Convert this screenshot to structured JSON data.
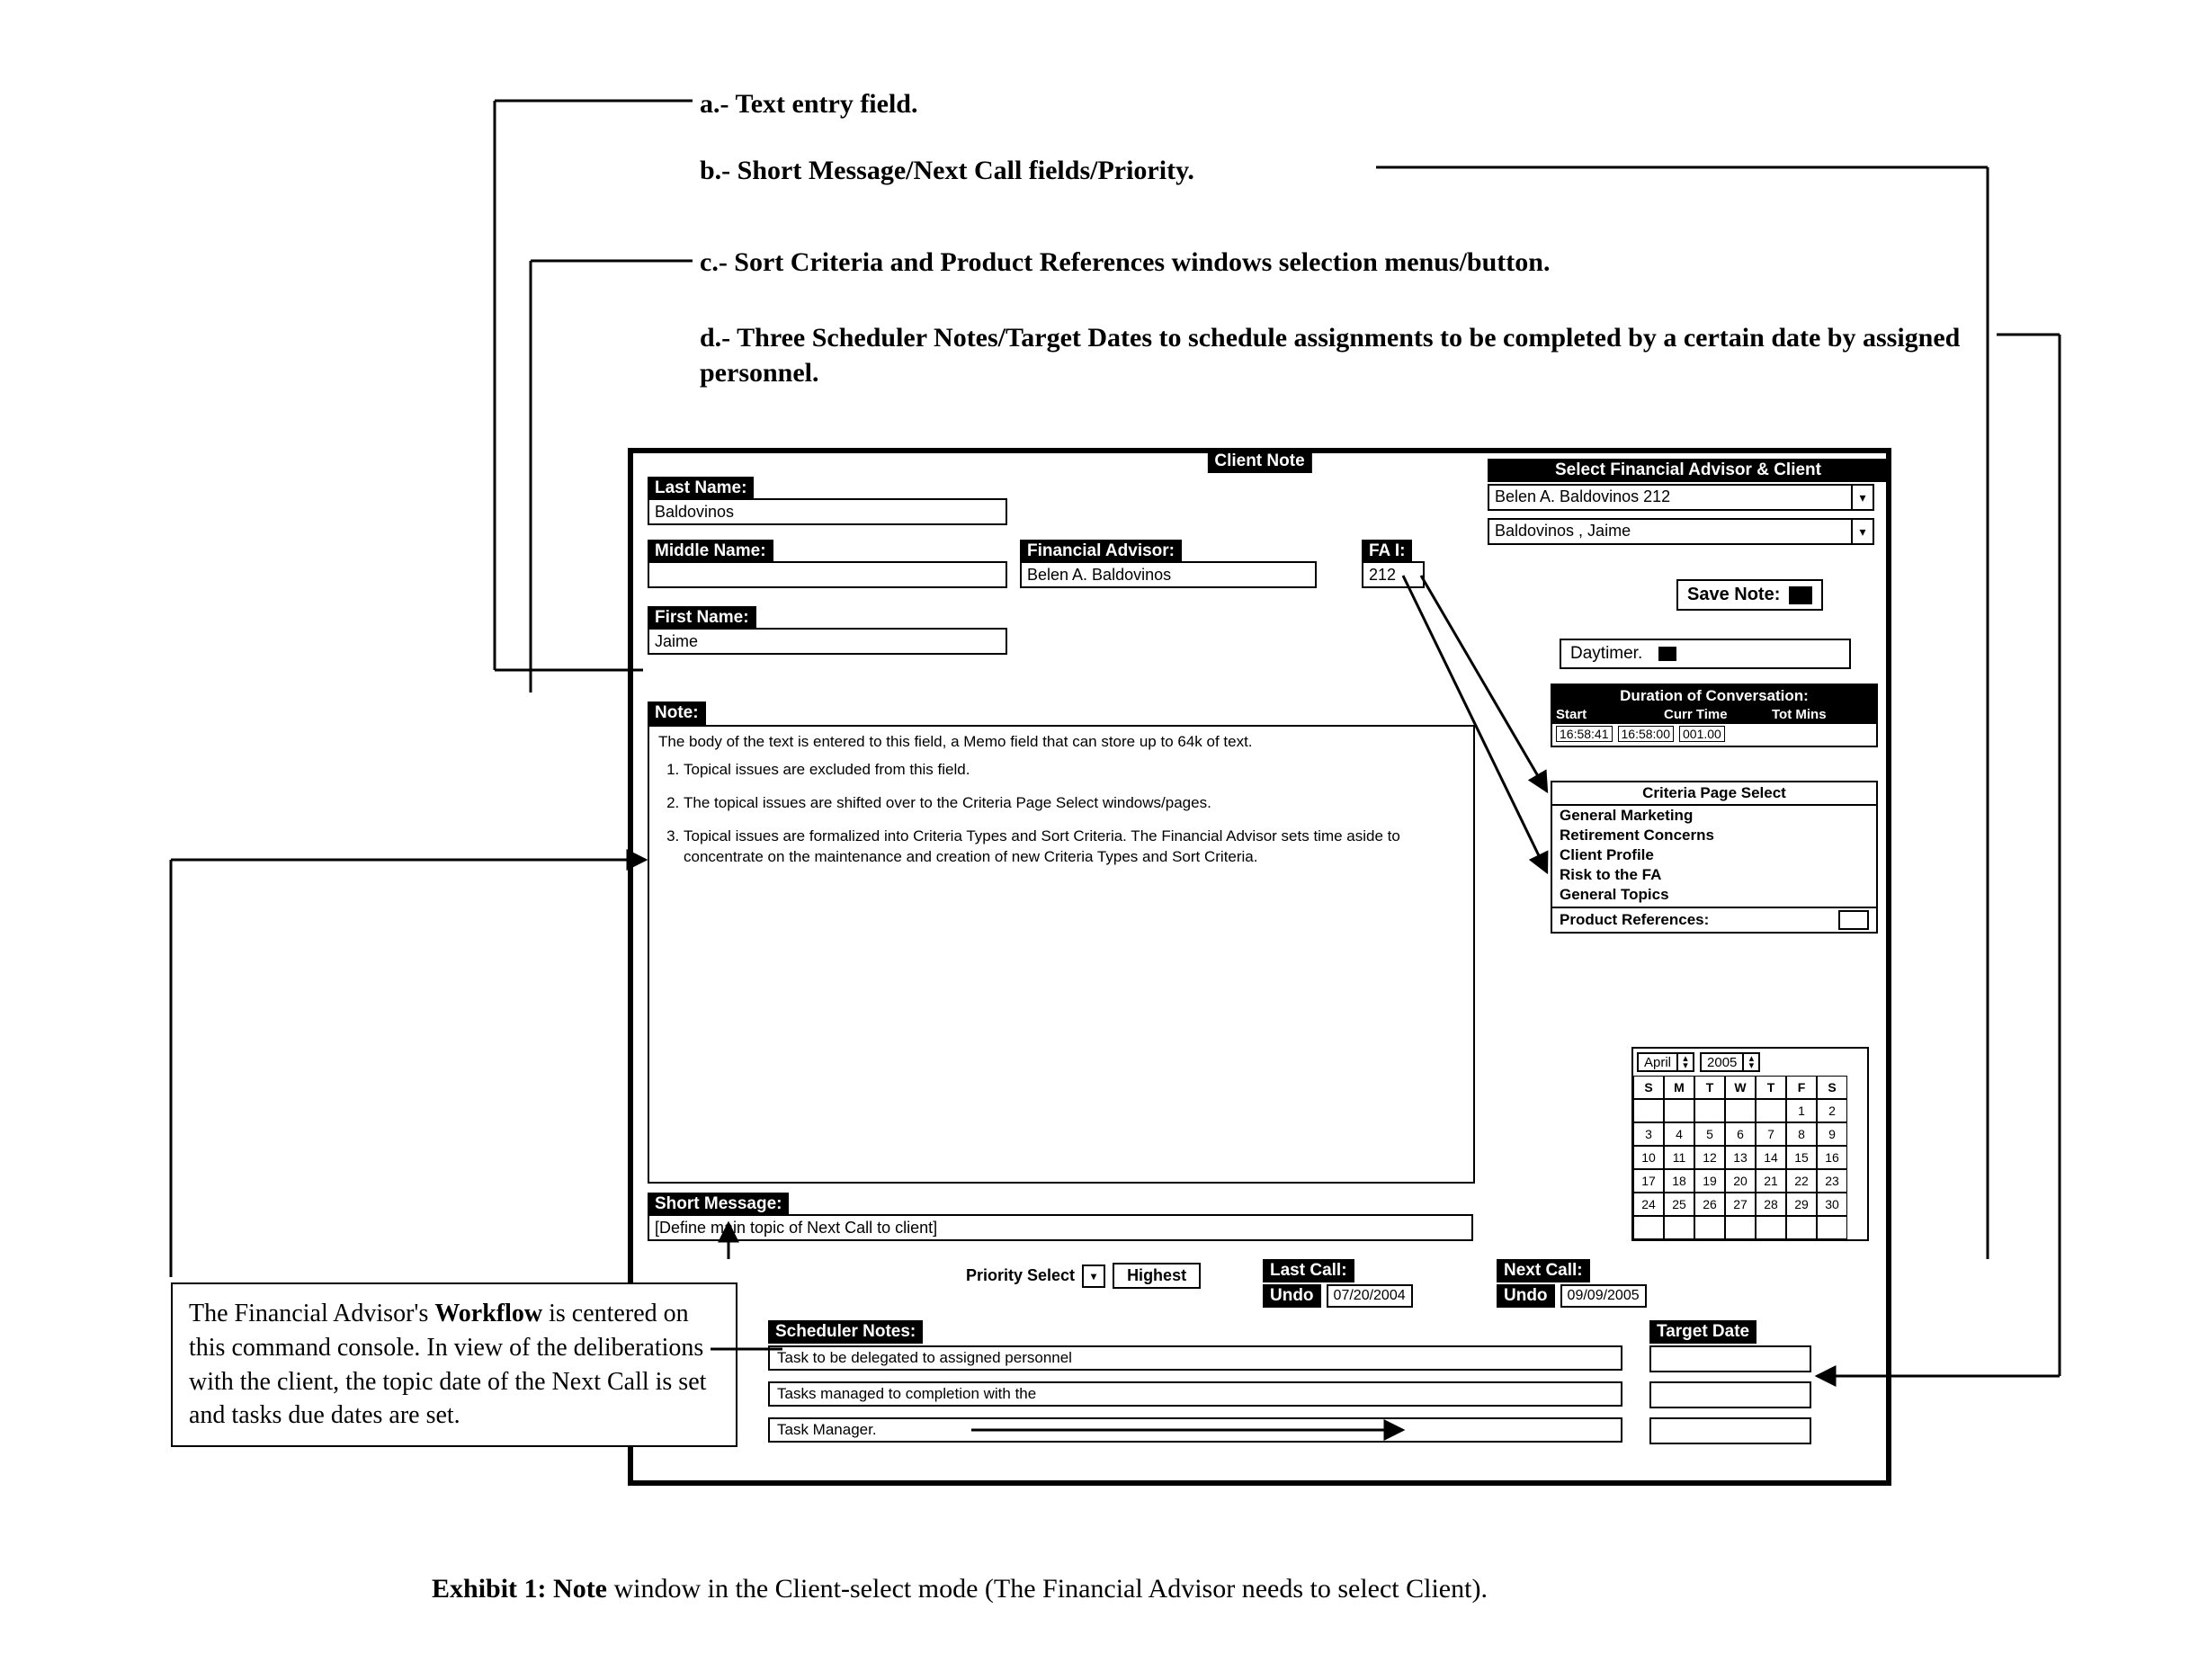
{
  "annotations": {
    "a": "a.- Text entry field.",
    "b": "b.- Short Message/Next Call fields/Priority.",
    "c": "c.- Sort Criteria and Product References windows selection menus/button.",
    "d": "d.- Three Scheduler Notes/Target Dates to schedule assignments to be completed by a certain date by assigned personnel."
  },
  "window": {
    "title": "Client Note",
    "last_name": {
      "label": "Last Name:",
      "value": "Baldovinos"
    },
    "middle_name": {
      "label": "Middle Name:",
      "value": ""
    },
    "first_name": {
      "label": "First Name:",
      "value": "Jaime"
    },
    "fin_advisor": {
      "label": "Financial Advisor:",
      "value": "Belen A. Baldovinos"
    },
    "fa_id": {
      "label": "FA I:",
      "value": "212"
    },
    "note_label": "Note:",
    "note_intro": "The body of the text is entered to this field, a Memo field that can store up to 64k of text.",
    "note_bullets": [
      "Topical issues are excluded from this field.",
      "The topical issues are shifted over to the Criteria Page Select windows/pages.",
      "Topical issues are formalized into Criteria Types and Sort Criteria.  The Financial Advisor sets time aside to concentrate on the maintenance and creation of new Criteria Types and Sort Criteria."
    ],
    "short_message": {
      "label": "Short Message:",
      "placeholder": "[Define main topic of Next Call to client]"
    },
    "priority": {
      "label": "Priority Select",
      "value": "Highest"
    },
    "last_call": {
      "label": "Last Call:",
      "undo": "Undo",
      "value": "07/20/2004"
    },
    "next_call": {
      "label": "Next Call:",
      "undo": "Undo",
      "value": "09/09/2005"
    },
    "scheduler": {
      "label": "Scheduler Notes:",
      "rows": [
        "Task to be delegated to assigned personnel",
        "Tasks managed to completion with the",
        "Task Manager."
      ],
      "target_label": "Target Date"
    }
  },
  "right": {
    "select_header": "Select Financial Advisor & Client",
    "advisor_selected": "Belen A. Baldovinos   212",
    "client_selected": "Baldovinos , Jaime",
    "save_note": "Save Note:",
    "daytimer": "Daytimer.",
    "duration": {
      "head": "Duration of Conversation:",
      "cols": [
        "Start",
        "Curr Time",
        "Tot Mins"
      ],
      "vals": [
        "16:58:41",
        "16:58:00",
        "001.00"
      ]
    },
    "criteria": {
      "head": "Criteria Page Select",
      "items": [
        "General Marketing",
        "Retirement Concerns",
        "Client Profile",
        "Risk to the FA",
        "General Topics"
      ],
      "prod_ref": "Product References:"
    },
    "calendar": {
      "month": "April",
      "year": "2005",
      "dow": [
        "S",
        "M",
        "T",
        "W",
        "T",
        "F",
        "S"
      ],
      "cells": [
        [
          "",
          "",
          "",
          "",
          "",
          "1",
          "2"
        ],
        [
          "3",
          "4",
          "5",
          "6",
          "7",
          "8",
          "9"
        ],
        [
          "10",
          "11",
          "12",
          "13",
          "14",
          "15",
          "16"
        ],
        [
          "17",
          "18",
          "19",
          "20",
          "21",
          "22",
          "23"
        ],
        [
          "24",
          "25",
          "26",
          "27",
          "28",
          "29",
          "30"
        ],
        [
          "",
          "",
          "",
          "",
          "",
          "",
          ""
        ]
      ]
    }
  },
  "callout": "The Financial Advisor's Workflow is centered on this command console.  In view of the deliberations with the client, the topic date of the Next Call is set and tasks due dates are set.",
  "caption": "Exhibit 1: Note window in the Client-select mode (The Financial Advisor needs to select Client)."
}
